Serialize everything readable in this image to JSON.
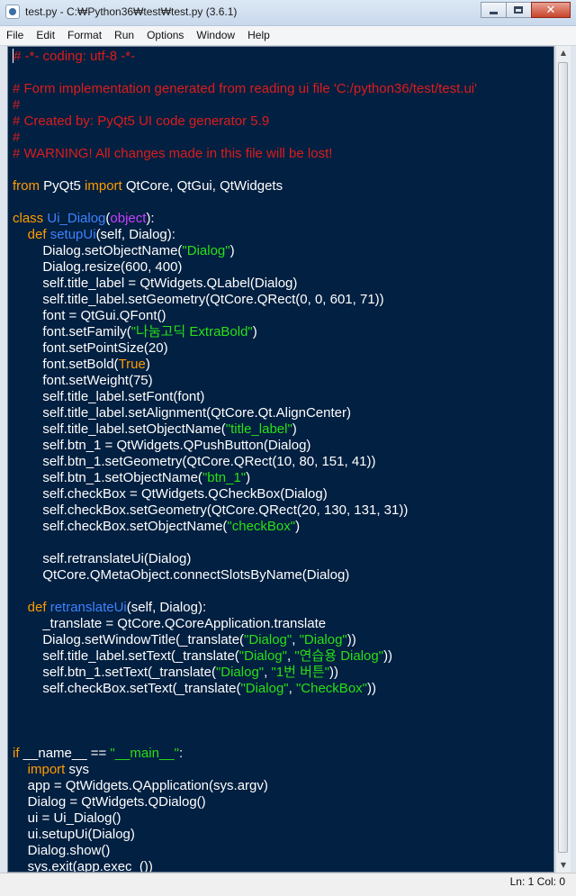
{
  "window": {
    "title": "test.py - C:₩Python36₩test₩test.py (3.6.1)",
    "close_glyph": "✕"
  },
  "menu": [
    "File",
    "Edit",
    "Format",
    "Run",
    "Options",
    "Window",
    "Help"
  ],
  "editor": {
    "lines": [
      [
        {
          "t": "# -*- coding: utf-8 -*-",
          "c": "cm"
        }
      ],
      [],
      [
        {
          "t": "# Form implementation generated from reading ui file 'C:/python36/test/test.ui'",
          "c": "cm"
        }
      ],
      [
        {
          "t": "#",
          "c": "cm"
        }
      ],
      [
        {
          "t": "# Created by: PyQt5 UI code generator 5.9",
          "c": "cm"
        }
      ],
      [
        {
          "t": "#",
          "c": "cm"
        }
      ],
      [
        {
          "t": "# WARNING! All changes made in this file will be lost!",
          "c": "cm"
        }
      ],
      [],
      [
        {
          "t": "from",
          "c": "kw"
        },
        {
          "t": " PyQt5 "
        },
        {
          "t": "import",
          "c": "kw"
        },
        {
          "t": " QtCore, QtGui, QtWidgets"
        }
      ],
      [],
      [
        {
          "t": "class",
          "c": "kw"
        },
        {
          "t": " "
        },
        {
          "t": "Ui_Dialog",
          "c": "df"
        },
        {
          "t": "("
        },
        {
          "t": "object",
          "c": "bi"
        },
        {
          "t": "):"
        }
      ],
      [
        {
          "t": "    "
        },
        {
          "t": "def",
          "c": "kw"
        },
        {
          "t": " "
        },
        {
          "t": "setupUi",
          "c": "df"
        },
        {
          "t": "(self, Dialog):"
        }
      ],
      [
        {
          "t": "        Dialog.setObjectName("
        },
        {
          "t": "\"Dialog\"",
          "c": "st"
        },
        {
          "t": ")"
        }
      ],
      [
        {
          "t": "        Dialog.resize(600, 400)"
        }
      ],
      [
        {
          "t": "        self.title_label = QtWidgets.QLabel(Dialog)"
        }
      ],
      [
        {
          "t": "        self.title_label.setGeometry(QtCore.QRect(0, 0, 601, 71))"
        }
      ],
      [
        {
          "t": "        font = QtGui.QFont()"
        }
      ],
      [
        {
          "t": "        font.setFamily("
        },
        {
          "t": "\"나눔고딕 ExtraBold\"",
          "c": "st"
        },
        {
          "t": ")"
        }
      ],
      [
        {
          "t": "        font.setPointSize(20)"
        }
      ],
      [
        {
          "t": "        font.setBold("
        },
        {
          "t": "True",
          "c": "kw"
        },
        {
          "t": ")"
        }
      ],
      [
        {
          "t": "        font.setWeight(75)"
        }
      ],
      [
        {
          "t": "        self.title_label.setFont(font)"
        }
      ],
      [
        {
          "t": "        self.title_label.setAlignment(QtCore.Qt.AlignCenter)"
        }
      ],
      [
        {
          "t": "        self.title_label.setObjectName("
        },
        {
          "t": "\"title_label\"",
          "c": "st"
        },
        {
          "t": ")"
        }
      ],
      [
        {
          "t": "        self.btn_1 = QtWidgets.QPushButton(Dialog)"
        }
      ],
      [
        {
          "t": "        self.btn_1.setGeometry(QtCore.QRect(10, 80, 151, 41))"
        }
      ],
      [
        {
          "t": "        self.btn_1.setObjectName("
        },
        {
          "t": "\"btn_1\"",
          "c": "st"
        },
        {
          "t": ")"
        }
      ],
      [
        {
          "t": "        self.checkBox = QtWidgets.QCheckBox(Dialog)"
        }
      ],
      [
        {
          "t": "        self.checkBox.setGeometry(QtCore.QRect(20, 130, 131, 31))"
        }
      ],
      [
        {
          "t": "        self.checkBox.setObjectName("
        },
        {
          "t": "\"checkBox\"",
          "c": "st"
        },
        {
          "t": ")"
        }
      ],
      [],
      [
        {
          "t": "        self.retranslateUi(Dialog)"
        }
      ],
      [
        {
          "t": "        QtCore.QMetaObject.connectSlotsByName(Dialog)"
        }
      ],
      [],
      [
        {
          "t": "    "
        },
        {
          "t": "def",
          "c": "kw"
        },
        {
          "t": " "
        },
        {
          "t": "retranslateUi",
          "c": "df"
        },
        {
          "t": "(self, Dialog):"
        }
      ],
      [
        {
          "t": "        _translate = QtCore.QCoreApplication.translate"
        }
      ],
      [
        {
          "t": "        Dialog.setWindowTitle(_translate("
        },
        {
          "t": "\"Dialog\"",
          "c": "st"
        },
        {
          "t": ", "
        },
        {
          "t": "\"Dialog\"",
          "c": "st"
        },
        {
          "t": "))"
        }
      ],
      [
        {
          "t": "        self.title_label.setText(_translate("
        },
        {
          "t": "\"Dialog\"",
          "c": "st"
        },
        {
          "t": ", "
        },
        {
          "t": "\"연습용 Dialog\"",
          "c": "st"
        },
        {
          "t": "))"
        }
      ],
      [
        {
          "t": "        self.btn_1.setText(_translate("
        },
        {
          "t": "\"Dialog\"",
          "c": "st"
        },
        {
          "t": ", "
        },
        {
          "t": "\"1번 버튼\"",
          "c": "st"
        },
        {
          "t": "))"
        }
      ],
      [
        {
          "t": "        self.checkBox.setText(_translate("
        },
        {
          "t": "\"Dialog\"",
          "c": "st"
        },
        {
          "t": ", "
        },
        {
          "t": "\"CheckBox\"",
          "c": "st"
        },
        {
          "t": "))"
        }
      ],
      [],
      [],
      [],
      [
        {
          "t": "if",
          "c": "kw"
        },
        {
          "t": " __name__ == "
        },
        {
          "t": "\"__main__\"",
          "c": "st"
        },
        {
          "t": ":"
        }
      ],
      [
        {
          "t": "    "
        },
        {
          "t": "import",
          "c": "kw"
        },
        {
          "t": " sys"
        }
      ],
      [
        {
          "t": "    app = QtWidgets.QApplication(sys.argv)"
        }
      ],
      [
        {
          "t": "    Dialog = QtWidgets.QDialog()"
        }
      ],
      [
        {
          "t": "    ui = Ui_Dialog()"
        }
      ],
      [
        {
          "t": "    ui.setupUi(Dialog)"
        }
      ],
      [
        {
          "t": "    Dialog.show()"
        }
      ],
      [
        {
          "t": "    sys.exit(app.exec_())"
        }
      ]
    ]
  },
  "scrollbar": {
    "up_glyph": "▲",
    "down_glyph": "▼"
  },
  "status": {
    "text": "Ln: 1   Col: 0"
  }
}
